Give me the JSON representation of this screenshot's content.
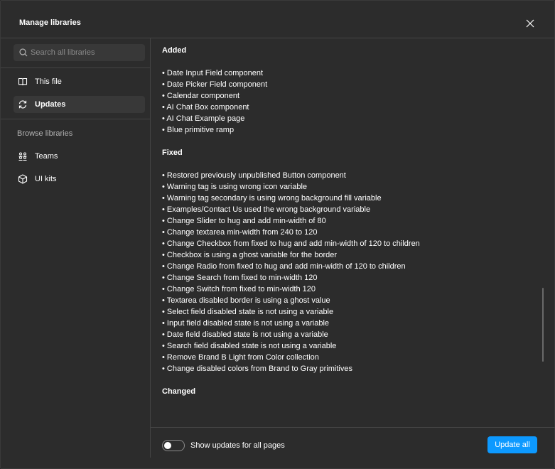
{
  "dialog": {
    "title": "Manage libraries"
  },
  "search": {
    "placeholder": "Search all libraries",
    "value": ""
  },
  "sidebar": {
    "items": [
      {
        "label": "This file",
        "icon": "book-icon",
        "active": false
      },
      {
        "label": "Updates",
        "icon": "refresh-icon",
        "active": true
      }
    ],
    "browse_label": "Browse libraries",
    "browse_items": [
      {
        "label": "Teams",
        "icon": "teams-icon"
      },
      {
        "label": "UI kits",
        "icon": "cube-icon"
      }
    ]
  },
  "content": {
    "sections": [
      {
        "heading": "Added",
        "items": [
          "Date Input Field component",
          "Date Picker Field component",
          "Calendar component",
          "AI Chat Box component",
          "AI Chat Example page",
          "Blue primitive ramp"
        ]
      },
      {
        "heading": "Fixed",
        "items": [
          "Restored previously unpublished Button component",
          "Warning tag is using wrong icon variable",
          "Warning tag secondary is using wrong background fill variable",
          "Examples/Contact Us used the wrong background variable",
          "Change Slider to hug and add min-width of 80",
          "Change textarea min-width from 240 to 120",
          "Change Checkbox from fixed to hug and add min-width of 120 to children",
          "Checkbox is using a ghost variable for the border",
          "Change Radio from fixed to hug and add min-width of 120 to children",
          "Change Search from fixed to min-width 120",
          "Change Switch from fixed to min-width 120",
          "Textarea disabled border is using a ghost value",
          "Select field disabled state is not using a variable",
          "Input field disabled state is not using a variable",
          "Date field disabled state is not using a variable",
          "Search field disabled state is not using a variable",
          "Remove Brand B Light from Color collection",
          "Change disabled colors from Brand to Gray primitives"
        ]
      },
      {
        "heading": "Changed",
        "items": []
      }
    ]
  },
  "footer": {
    "toggle_label": "Show updates for all pages",
    "toggle_on": false,
    "update_button": "Update all"
  },
  "colors": {
    "background": "#2c2c2c",
    "accent": "#0d99ff",
    "border": "#444444"
  }
}
